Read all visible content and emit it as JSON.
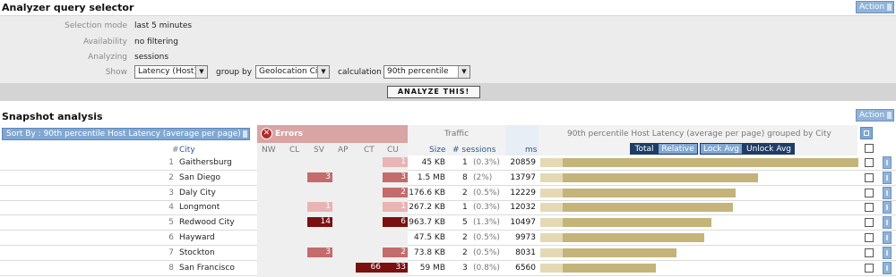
{
  "query": {
    "title": "Analyzer query selector",
    "action_label": "Action",
    "selection_mode_label": "Selection mode",
    "selection_mode_value": "last 5 minutes",
    "availability_label": "Availability",
    "availability_value": "no filtering",
    "analyzing_label": "Analyzing",
    "analyzing_value": "sessions",
    "show_label": "Show",
    "show_value": "Latency (Host)",
    "group_by_label": "group by",
    "group_by_value": "Geolocation City",
    "calculation_label": "calculation",
    "calculation_value": "90th percentile",
    "analyze_button": "ANALYZE THIS!"
  },
  "snapshot": {
    "title": "Snapshot analysis",
    "action_label": "Action",
    "sort_label": "Sort By : 90th percentile Host Latency (average per page)",
    "errors_label": "Errors",
    "traffic_label": "Traffic",
    "chart_title": "90th percentile Host Latency (average per page) grouped by City",
    "columns": {
      "hash": "#",
      "city": "City",
      "nw": "NW",
      "cl": "CL",
      "sv": "SV",
      "ap": "AP",
      "ct": "CT",
      "cu": "CU",
      "size": "Size",
      "sessions": "# sessions",
      "ms": "ms"
    },
    "view_buttons": [
      "Total",
      "Relative",
      "Lock Avg",
      "Unlock Avg"
    ],
    "max_ms": 20859,
    "rows": [
      {
        "n": "1",
        "city": "Gaithersburg",
        "sv": "",
        "cu": "1",
        "size": "45 KB",
        "sessions": "1",
        "pct": "(0.3%)",
        "ms": "20859",
        "value": 20859
      },
      {
        "n": "2",
        "city": "San Diego",
        "sv": "3",
        "cu": "3",
        "size": "1.5 MB",
        "sessions": "8",
        "pct": "(2%)",
        "ms": "13797",
        "value": 13797
      },
      {
        "n": "3",
        "city": "Daly City",
        "sv": "",
        "cu": "2",
        "size": "176.6 KB",
        "sessions": "2",
        "pct": "(0.5%)",
        "ms": "12229",
        "value": 12229
      },
      {
        "n": "4",
        "city": "Longmont",
        "sv": "1",
        "cu": "1",
        "size": "267.2 KB",
        "sessions": "1",
        "pct": "(0.3%)",
        "ms": "12032",
        "value": 12032
      },
      {
        "n": "5",
        "city": "Redwood City",
        "sv": "14",
        "cu": "6",
        "size": "963.7 KB",
        "sessions": "5",
        "pct": "(1.3%)",
        "ms": "10497",
        "value": 10497
      },
      {
        "n": "6",
        "city": "Hayward",
        "sv": "",
        "cu": "",
        "size": "47.5 KB",
        "sessions": "2",
        "pct": "(0.5%)",
        "ms": "9973",
        "value": 9973
      },
      {
        "n": "7",
        "city": "Stockton",
        "sv": "3",
        "cu": "2",
        "size": "73.8 KB",
        "sessions": "2",
        "pct": "(0.5%)",
        "ms": "8031",
        "value": 8031
      },
      {
        "n": "8",
        "city": "San Francisco",
        "sv": "",
        "ct": "66",
        "cu": "33",
        "size": "59 MB",
        "sessions": "3",
        "pct": "(0.8%)",
        "ms": "6560",
        "value": 6560
      }
    ]
  },
  "colors": {
    "bar": "#c4b47a",
    "error_light": "#e8b4b4",
    "error_mid": "#c46b6b",
    "error_dark": "#7a1010"
  }
}
